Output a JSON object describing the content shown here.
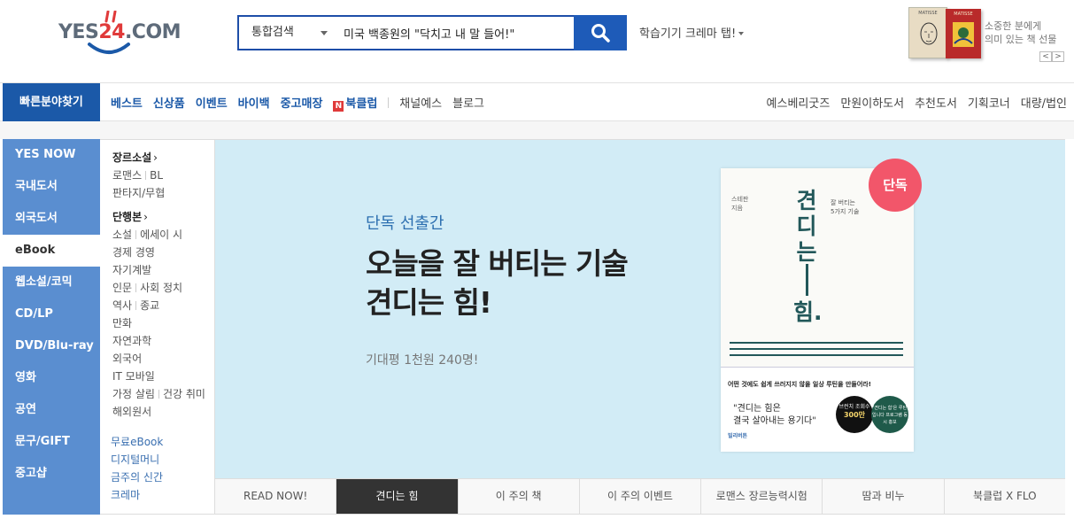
{
  "header": {
    "logo": {
      "pre": "YES",
      "num": "24",
      "post": ".COM"
    },
    "search": {
      "category": "통합검색",
      "query": "미국 백종원의 \"닥치고 내 말 들어!\""
    },
    "promo": "학습기기 크레마 탭!",
    "ad": {
      "book1_label": "MATISSE",
      "book2_label": "MATISSE",
      "line1": "소중한 분에게",
      "line2": "의미 있는 책 선물",
      "prev": "<",
      "next": ">"
    }
  },
  "nav": {
    "quick": "빠른분야찾기",
    "left": [
      "베스트",
      "신상품",
      "이벤트",
      "바이백",
      "중고매장"
    ],
    "bookclub_icon": "N",
    "bookclub": "북클럽",
    "left_gray": [
      "채널예스",
      "블로그"
    ],
    "right": [
      "예스베리굿즈",
      "만원이하도서",
      "추천도서",
      "기획코너",
      "대량/법인"
    ]
  },
  "categories": [
    {
      "label": "YES NOW",
      "active": false
    },
    {
      "label": "국내도서",
      "active": false
    },
    {
      "label": "외국도서",
      "active": false
    },
    {
      "label": "eBook",
      "active": true
    },
    {
      "label": "웹소설/코믹",
      "active": false
    },
    {
      "label": "CD/LP",
      "active": false
    },
    {
      "label": "DVD/Blu-ray",
      "active": false
    },
    {
      "label": "영화",
      "active": false
    },
    {
      "label": "공연",
      "active": false
    },
    {
      "label": "문구/GIFT",
      "active": false
    },
    {
      "label": "중고샵",
      "active": false
    }
  ],
  "subpanel": {
    "genre_head": "장르소설",
    "genre": {
      "a": "로맨스",
      "b": "BL",
      "c": "판타지/무협"
    },
    "single_head": "단행본",
    "chev": "›",
    "single": {
      "s1a": "소설",
      "s1b": "에세이 시",
      "s2": "경제 경영",
      "s3": "자기계발",
      "s4a": "인문",
      "s4b": "사회 정치",
      "s5a": "역사",
      "s5b": "종교",
      "s6": "만화",
      "s7": "자연과학",
      "s8": "외국어",
      "s9": "IT 모바일",
      "s10a": "가정 살림",
      "s10b": "건강 취미",
      "s11": "해외원서"
    },
    "extra": [
      "무료eBook",
      "디지털머니",
      "금주의 신간",
      "크레마"
    ]
  },
  "banner": {
    "eyebrow": "단독 선출간",
    "title1": "오늘을 잘 버티는 기술",
    "title2": "견디는 힘!",
    "desc": "기대평 1천원 240명!",
    "badge": "단독",
    "book": {
      "author": "스테판\n지음",
      "vtitle": "견디는",
      "vtitle2": "힘.",
      "sub": "잘 버티는\n5가지 기술",
      "tag": "어떤 것에도 쉽게 쓰러지지 않을 일상 루틴을 만들어라!",
      "quote1": "\"견디는 힘은",
      "quote2": "결국 살아내는 용기다\"",
      "circle1_small": "브런치 조회수",
      "circle1_big": "300만",
      "circle2": "'견디는 힘'은 루틴입니다 프로그램 동시 홍보",
      "publisher": "빌리버튼"
    }
  },
  "tabs": [
    {
      "label": "READ NOW!",
      "active": false
    },
    {
      "label": "견디는 힘",
      "active": true
    },
    {
      "label": "이 주의 책",
      "active": false
    },
    {
      "label": "이 주의 이벤트",
      "active": false
    },
    {
      "label": "로맨스 장르능력시험",
      "active": false
    },
    {
      "label": "땀과 비누",
      "active": false
    },
    {
      "label": "북클럽 X FLO",
      "active": false
    }
  ],
  "colors": {
    "brand_blue": "#1b59a8",
    "sidebar_blue": "#5a8ed0",
    "banner_bg": "#d2ecf6",
    "badge_red": "#f2566a",
    "book_green": "#22585a"
  }
}
